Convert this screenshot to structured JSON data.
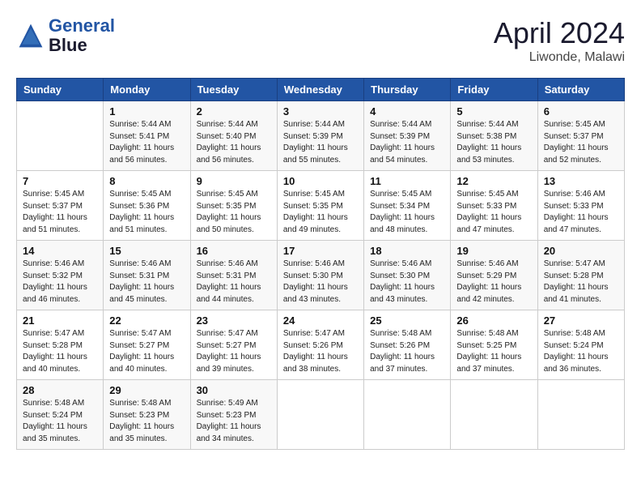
{
  "header": {
    "logo_line1": "General",
    "logo_line2": "Blue",
    "month": "April 2024",
    "location": "Liwonde, Malawi"
  },
  "columns": [
    "Sunday",
    "Monday",
    "Tuesday",
    "Wednesday",
    "Thursday",
    "Friday",
    "Saturday"
  ],
  "weeks": [
    [
      {
        "day": "",
        "detail": ""
      },
      {
        "day": "1",
        "detail": "Sunrise: 5:44 AM\nSunset: 5:41 PM\nDaylight: 11 hours\nand 56 minutes."
      },
      {
        "day": "2",
        "detail": "Sunrise: 5:44 AM\nSunset: 5:40 PM\nDaylight: 11 hours\nand 56 minutes."
      },
      {
        "day": "3",
        "detail": "Sunrise: 5:44 AM\nSunset: 5:39 PM\nDaylight: 11 hours\nand 55 minutes."
      },
      {
        "day": "4",
        "detail": "Sunrise: 5:44 AM\nSunset: 5:39 PM\nDaylight: 11 hours\nand 54 minutes."
      },
      {
        "day": "5",
        "detail": "Sunrise: 5:44 AM\nSunset: 5:38 PM\nDaylight: 11 hours\nand 53 minutes."
      },
      {
        "day": "6",
        "detail": "Sunrise: 5:45 AM\nSunset: 5:37 PM\nDaylight: 11 hours\nand 52 minutes."
      }
    ],
    [
      {
        "day": "7",
        "detail": "Sunrise: 5:45 AM\nSunset: 5:37 PM\nDaylight: 11 hours\nand 51 minutes."
      },
      {
        "day": "8",
        "detail": "Sunrise: 5:45 AM\nSunset: 5:36 PM\nDaylight: 11 hours\nand 51 minutes."
      },
      {
        "day": "9",
        "detail": "Sunrise: 5:45 AM\nSunset: 5:35 PM\nDaylight: 11 hours\nand 50 minutes."
      },
      {
        "day": "10",
        "detail": "Sunrise: 5:45 AM\nSunset: 5:35 PM\nDaylight: 11 hours\nand 49 minutes."
      },
      {
        "day": "11",
        "detail": "Sunrise: 5:45 AM\nSunset: 5:34 PM\nDaylight: 11 hours\nand 48 minutes."
      },
      {
        "day": "12",
        "detail": "Sunrise: 5:45 AM\nSunset: 5:33 PM\nDaylight: 11 hours\nand 47 minutes."
      },
      {
        "day": "13",
        "detail": "Sunrise: 5:46 AM\nSunset: 5:33 PM\nDaylight: 11 hours\nand 47 minutes."
      }
    ],
    [
      {
        "day": "14",
        "detail": "Sunrise: 5:46 AM\nSunset: 5:32 PM\nDaylight: 11 hours\nand 46 minutes."
      },
      {
        "day": "15",
        "detail": "Sunrise: 5:46 AM\nSunset: 5:31 PM\nDaylight: 11 hours\nand 45 minutes."
      },
      {
        "day": "16",
        "detail": "Sunrise: 5:46 AM\nSunset: 5:31 PM\nDaylight: 11 hours\nand 44 minutes."
      },
      {
        "day": "17",
        "detail": "Sunrise: 5:46 AM\nSunset: 5:30 PM\nDaylight: 11 hours\nand 43 minutes."
      },
      {
        "day": "18",
        "detail": "Sunrise: 5:46 AM\nSunset: 5:30 PM\nDaylight: 11 hours\nand 43 minutes."
      },
      {
        "day": "19",
        "detail": "Sunrise: 5:46 AM\nSunset: 5:29 PM\nDaylight: 11 hours\nand 42 minutes."
      },
      {
        "day": "20",
        "detail": "Sunrise: 5:47 AM\nSunset: 5:28 PM\nDaylight: 11 hours\nand 41 minutes."
      }
    ],
    [
      {
        "day": "21",
        "detail": "Sunrise: 5:47 AM\nSunset: 5:28 PM\nDaylight: 11 hours\nand 40 minutes."
      },
      {
        "day": "22",
        "detail": "Sunrise: 5:47 AM\nSunset: 5:27 PM\nDaylight: 11 hours\nand 40 minutes."
      },
      {
        "day": "23",
        "detail": "Sunrise: 5:47 AM\nSunset: 5:27 PM\nDaylight: 11 hours\nand 39 minutes."
      },
      {
        "day": "24",
        "detail": "Sunrise: 5:47 AM\nSunset: 5:26 PM\nDaylight: 11 hours\nand 38 minutes."
      },
      {
        "day": "25",
        "detail": "Sunrise: 5:48 AM\nSunset: 5:26 PM\nDaylight: 11 hours\nand 37 minutes."
      },
      {
        "day": "26",
        "detail": "Sunrise: 5:48 AM\nSunset: 5:25 PM\nDaylight: 11 hours\nand 37 minutes."
      },
      {
        "day": "27",
        "detail": "Sunrise: 5:48 AM\nSunset: 5:24 PM\nDaylight: 11 hours\nand 36 minutes."
      }
    ],
    [
      {
        "day": "28",
        "detail": "Sunrise: 5:48 AM\nSunset: 5:24 PM\nDaylight: 11 hours\nand 35 minutes."
      },
      {
        "day": "29",
        "detail": "Sunrise: 5:48 AM\nSunset: 5:23 PM\nDaylight: 11 hours\nand 35 minutes."
      },
      {
        "day": "30",
        "detail": "Sunrise: 5:49 AM\nSunset: 5:23 PM\nDaylight: 11 hours\nand 34 minutes."
      },
      {
        "day": "",
        "detail": ""
      },
      {
        "day": "",
        "detail": ""
      },
      {
        "day": "",
        "detail": ""
      },
      {
        "day": "",
        "detail": ""
      }
    ]
  ]
}
